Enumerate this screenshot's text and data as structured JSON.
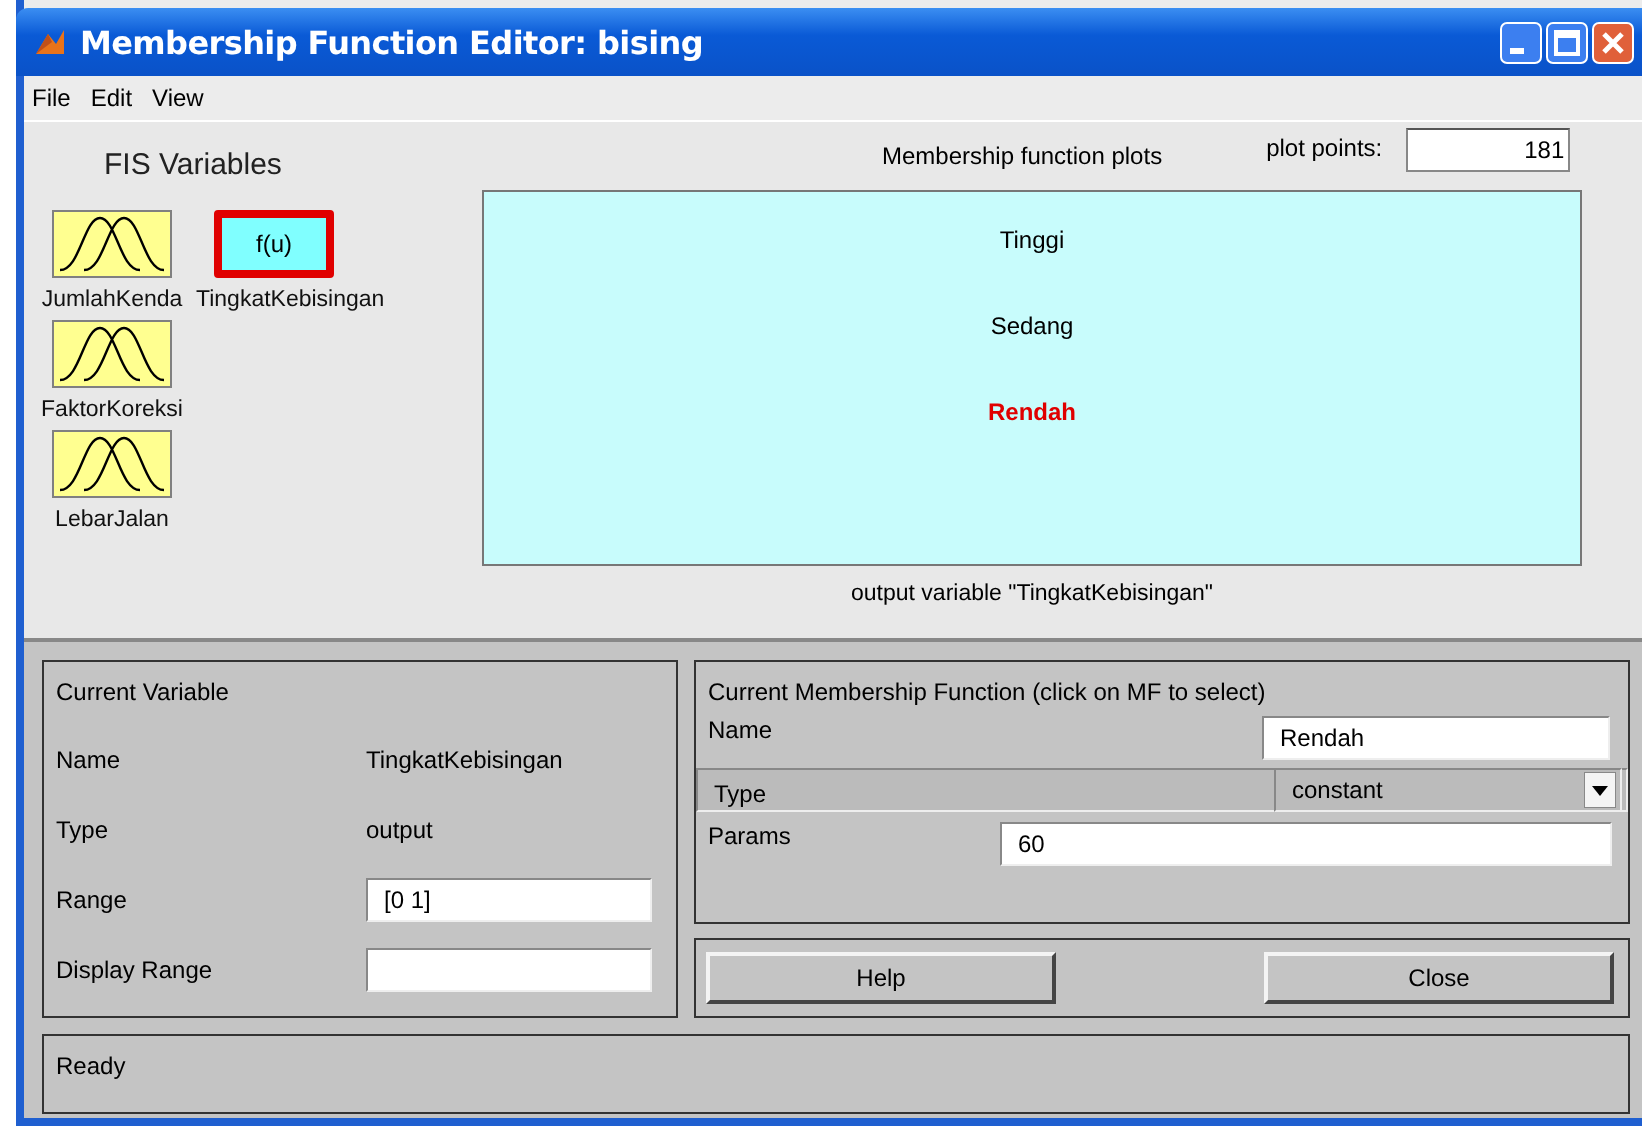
{
  "window": {
    "title": "Membership Function Editor: bising"
  },
  "menu": [
    "File",
    "Edit",
    "View"
  ],
  "fis_variables": {
    "title": "FIS Variables",
    "items": [
      {
        "label": "JumlahKenda",
        "kind": "input",
        "selected": false
      },
      {
        "label": "TingkatKebisingan",
        "kind": "output",
        "selected": true,
        "icon_text": "f(u)"
      },
      {
        "label": "FaktorKoreksi",
        "kind": "input",
        "selected": false
      },
      {
        "label": "LebarJalan",
        "kind": "input",
        "selected": false
      }
    ]
  },
  "plot": {
    "title": "Membership function plots",
    "plot_points_label": "plot points:",
    "plot_points": "181",
    "membership_functions": [
      {
        "label": "Tinggi",
        "selected": false
      },
      {
        "label": "Sedang",
        "selected": false
      },
      {
        "label": "Rendah",
        "selected": true
      }
    ],
    "caption": "output variable \"TingkatKebisingan\""
  },
  "current_variable": {
    "title": "Current Variable",
    "fields": [
      {
        "label": "Name",
        "value": "TingkatKebisingan",
        "kind": "text"
      },
      {
        "label": "Type",
        "value": "output",
        "kind": "text"
      },
      {
        "label": "Range",
        "value": "[0 1]",
        "kind": "input"
      },
      {
        "label": "Display Range",
        "kind": "input"
      }
    ]
  },
  "current_mf": {
    "title": "Current Membership Function (click on MF to select)",
    "fields": [
      {
        "label": "Name",
        "value": "Rendah",
        "kind": "input"
      },
      {
        "label": "Type",
        "value": "constant",
        "kind": "select"
      },
      {
        "label": "Params",
        "value": "60",
        "kind": "wide"
      }
    ]
  },
  "buttons": [
    "Help",
    "Close"
  ],
  "status": "Ready"
}
